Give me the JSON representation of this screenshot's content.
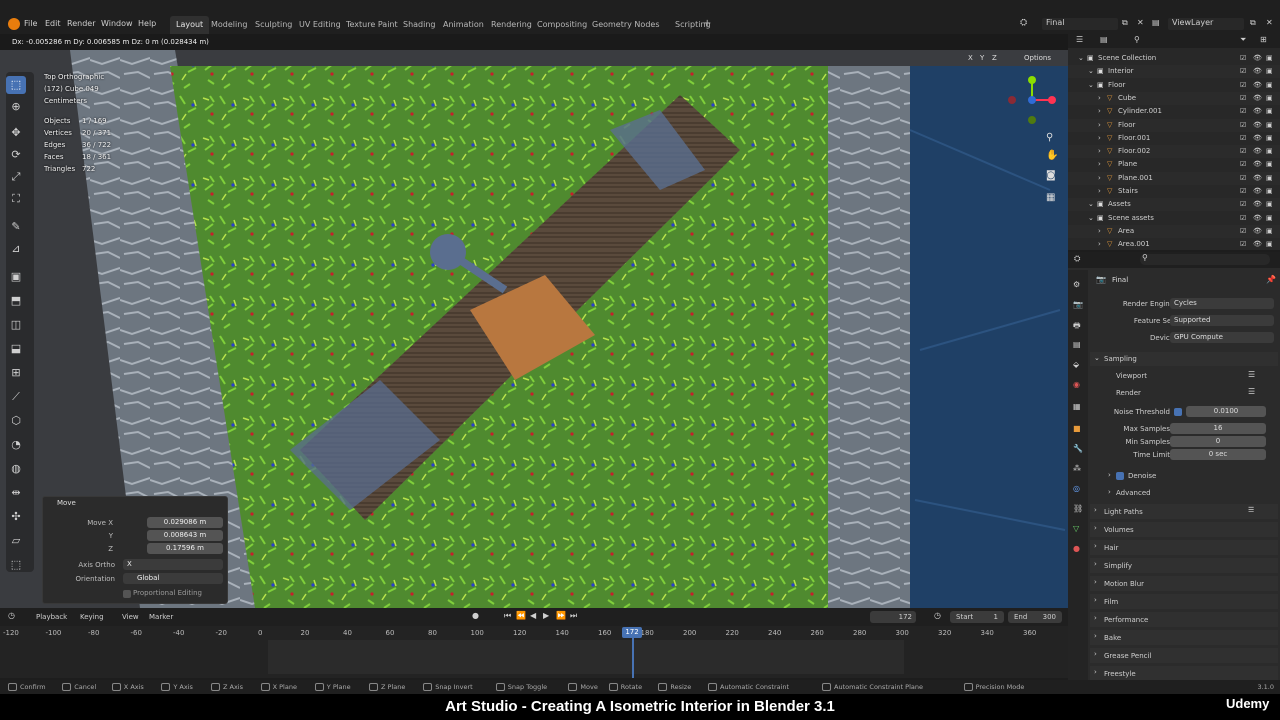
{
  "menu": [
    "File",
    "Edit",
    "Render",
    "Window",
    "Help"
  ],
  "workspaces": [
    "Layout",
    "Modeling",
    "Sculpting",
    "UV Editing",
    "Texture Paint",
    "Shading",
    "Animation",
    "Rendering",
    "Compositing",
    "Geometry Nodes",
    "Scripting"
  ],
  "workspace_add": "+",
  "scene_name": "Final",
  "view_layer": "ViewLayer",
  "header_readout": "Dx: -0.005286 m  Dy: 0.006585 m  Dz: 0 m (0.028434 m)",
  "viewport": {
    "options_label": "Options",
    "view_name": "Top Orthographic",
    "object_name": "(172) Cube.049",
    "units": "Centimeters",
    "stats": [
      {
        "label": "Objects",
        "value": "1 / 169"
      },
      {
        "label": "Vertices",
        "value": "20 / 371"
      },
      {
        "label": "Edges",
        "value": "36 / 722"
      },
      {
        "label": "Faces",
        "value": "18 / 361"
      },
      {
        "label": "Triangles",
        "value": "722"
      }
    ],
    "axes": {
      "x": "X",
      "y": "Y",
      "z": "Z"
    }
  },
  "move_panel": {
    "title": "Move",
    "move_x_label": "Move X",
    "move_x": "0.029086 m",
    "y_label": "Y",
    "y": "0.008643 m",
    "z_label": "Z",
    "z": "0.17596 m",
    "axis_ortho_label": "Axis Ortho",
    "axis_ortho": "X",
    "orientation_label": "Orientation",
    "orientation": "Global",
    "proportional_label": "Proportional Editing"
  },
  "outliner": {
    "rows": [
      {
        "label": "Scene Collection",
        "indent": 0
      },
      {
        "label": "Interior",
        "indent": 1
      },
      {
        "label": "Floor",
        "indent": 1
      },
      {
        "label": "Cube",
        "indent": 2
      },
      {
        "label": "Cylinder.001",
        "indent": 2
      },
      {
        "label": "Floor",
        "indent": 2
      },
      {
        "label": "Floor.001",
        "indent": 2
      },
      {
        "label": "Floor.002",
        "indent": 2
      },
      {
        "label": "Plane",
        "indent": 2
      },
      {
        "label": "Plane.001",
        "indent": 2
      },
      {
        "label": "Stairs",
        "indent": 2
      },
      {
        "label": "Assets",
        "indent": 1
      },
      {
        "label": "Scene assets",
        "indent": 1
      },
      {
        "label": "Area",
        "indent": 2
      },
      {
        "label": "Area.001",
        "indent": 2
      }
    ]
  },
  "properties": {
    "context_name": "Final",
    "render_engine_label": "Render Engine",
    "render_engine": "Cycles",
    "feature_set_label": "Feature Set",
    "feature_set": "Supported",
    "device_label": "Device",
    "device": "GPU Compute",
    "sampling_label": "Sampling",
    "viewport_label": "Viewport",
    "render_label": "Render",
    "noise_threshold_label": "Noise Threshold",
    "noise_threshold": "0.0100",
    "max_samples_label": "Max Samples",
    "max_samples": "16",
    "min_samples_label": "Min Samples",
    "min_samples": "0",
    "time_limit_label": "Time Limit",
    "time_limit": "0 sec",
    "denoise_label": "Denoise",
    "advanced_label": "Advanced",
    "panels": [
      "Light Paths",
      "Volumes",
      "Hair",
      "Simplify",
      "Motion Blur",
      "Film",
      "Performance",
      "Bake",
      "Grease Pencil",
      "Freestyle"
    ]
  },
  "timeline": {
    "menus": [
      "Playback",
      "Keying",
      "View",
      "Marker"
    ],
    "current_frame": "172",
    "start_label": "Start",
    "start": "1",
    "end_label": "End",
    "end": "300",
    "ticks": [
      "-120",
      "-100",
      "-80",
      "-60",
      "-40",
      "-20",
      "0",
      "20",
      "40",
      "60",
      "80",
      "100",
      "120",
      "140",
      "160",
      "180",
      "200",
      "220",
      "240",
      "260",
      "280",
      "300",
      "320",
      "340",
      "360"
    ]
  },
  "statusbar": [
    "Confirm",
    "Cancel",
    "X Axis",
    "Y Axis",
    "Z Axis",
    "X Plane",
    "Y Plane",
    "Z Plane",
    "Snap Invert",
    "Snap Toggle",
    "Move",
    "Rotate",
    "Resize",
    "Automatic Constraint",
    "Automatic Constraint Plane",
    "Precision Mode"
  ],
  "version": "3.1.0",
  "watermark": "Udemy",
  "caption": "Art Studio - Creating A Isometric Interior in Blender 3.1"
}
